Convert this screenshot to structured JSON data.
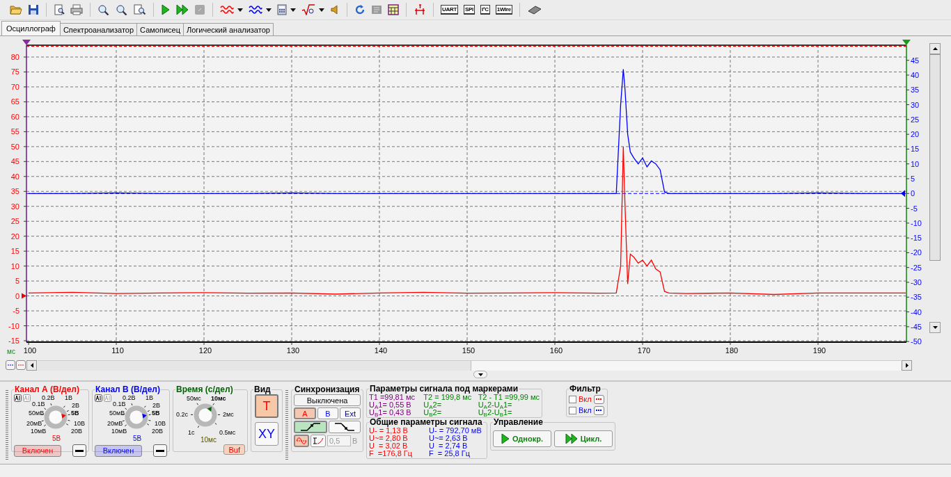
{
  "toolbar": [
    {
      "kind": "open"
    },
    {
      "kind": "save"
    },
    {
      "kind": "separator"
    },
    {
      "kind": "preview"
    },
    {
      "kind": "print"
    },
    {
      "kind": "separator"
    },
    {
      "kind": "zoom"
    },
    {
      "kind": "zoom"
    },
    {
      "kind": "zoom-page"
    },
    {
      "kind": "separator"
    },
    {
      "kind": "play"
    },
    {
      "kind": "play-fast"
    },
    {
      "kind": "stop",
      "disabled": true
    },
    {
      "kind": "separator"
    },
    {
      "kind": "wave",
      "color": "#ff0000",
      "dropdown": true
    },
    {
      "kind": "wave",
      "color": "#0000ff",
      "dropdown": true
    },
    {
      "kind": "calculator",
      "dropdown": true
    },
    {
      "kind": "sqrt",
      "dropdown": true
    },
    {
      "kind": "speaker"
    },
    {
      "kind": "separator"
    },
    {
      "kind": "refresh"
    },
    {
      "kind": "note"
    },
    {
      "kind": "table"
    },
    {
      "kind": "separator"
    },
    {
      "kind": "marker"
    },
    {
      "kind": "separator"
    },
    {
      "kind": "protocol",
      "label": "UART"
    },
    {
      "kind": "protocol",
      "label": "SPI"
    },
    {
      "kind": "protocol",
      "label": "I²C"
    },
    {
      "kind": "protocol",
      "label": "1Wire"
    },
    {
      "kind": "separator"
    },
    {
      "kind": "chip"
    }
  ],
  "tabs": [
    {
      "label": "Осциллограф",
      "selected": true
    },
    {
      "label": "Спектроанализатор",
      "selected": false
    },
    {
      "label": "Самописец",
      "selected": false
    },
    {
      "label": "Логический анализатор",
      "selected": false
    }
  ],
  "scope": {
    "chart_data": {
      "type": "line",
      "grid": true,
      "ref_lines": [
        {
          "axis": "y2",
          "value": 0,
          "color": "#0000ff"
        }
      ],
      "xlabel": "мс",
      "xlim": [
        99.76,
        200.08
      ],
      "ylim": [
        -15.46,
        83.96
      ],
      "y2lim": [
        -50.2,
        50.1
      ],
      "xticks": [
        100,
        110,
        120,
        130,
        140,
        150,
        160,
        170,
        180,
        190
      ],
      "yticks": [
        -15,
        -10,
        -5,
        0,
        5,
        10,
        15,
        20,
        25,
        30,
        35,
        40,
        45,
        50,
        55,
        60,
        65,
        70,
        75,
        80
      ],
      "y2ticks": [
        -50,
        -45,
        -40,
        -35,
        -30,
        -25,
        -20,
        -15,
        -10,
        -5,
        0,
        5,
        10,
        15,
        20,
        25,
        30,
        35,
        40,
        45
      ],
      "x": [
        100,
        105,
        110,
        115,
        120,
        125,
        130,
        135,
        140,
        145,
        150,
        155,
        160,
        165,
        167,
        167.5,
        167.8,
        168,
        168.3,
        168.6,
        169,
        169.5,
        170,
        170.5,
        171,
        171.5,
        172,
        172.5,
        173,
        175,
        180,
        185,
        190,
        195,
        200
      ],
      "series": [
        {
          "color": "#ff0000",
          "values": [
            1,
            1.2,
            0.8,
            1,
            1.1,
            0.9,
            1,
            0.6,
            1,
            1.2,
            0.9,
            1,
            1.1,
            0.9,
            1,
            10,
            50,
            30,
            4,
            14,
            13,
            11,
            12,
            10,
            12,
            9,
            8,
            1.5,
            1,
            0.8,
            1,
            0.5,
            1,
            1,
            1
          ]
        },
        {
          "color": "#0000ff",
          "axis": "y2",
          "values": [
            0,
            0,
            0.2,
            0,
            0,
            0,
            0.2,
            0,
            0,
            0,
            0,
            0,
            0,
            0,
            0,
            30,
            42,
            35,
            20,
            14,
            12,
            10,
            12,
            9,
            11,
            10,
            8,
            0.5,
            0,
            0,
            0,
            0,
            0.2,
            0,
            0
          ]
        }
      ]
    }
  },
  "knob_panels": [
    {
      "kind": "channel",
      "title": "Канал А (В/дел)",
      "color": "#ff0000",
      "scale": [
        {
          "label": "0.2В",
          "selected": false
        },
        {
          "label": "1В",
          "selected": false
        },
        {
          "label": "0.1В",
          "selected": false
        },
        {
          "label": "2В",
          "selected": false
        },
        {
          "label": "50мВ",
          "selected": false
        },
        {
          "label": "5В",
          "selected": true
        },
        {
          "label": "20мВ",
          "selected": false
        },
        {
          "label": "10В",
          "selected": false
        },
        {
          "label": "10мВ",
          "selected": false
        },
        {
          "label": "20В",
          "selected": false
        }
      ],
      "value": "5В",
      "power_button": "Включен"
    },
    {
      "kind": "channel",
      "title": "Канал B (В/дел)",
      "color": "#0000ff",
      "scale": [
        {
          "label": "0.2В",
          "selected": false
        },
        {
          "label": "1В",
          "selected": false
        },
        {
          "label": "0.1В",
          "selected": false
        },
        {
          "label": "2В",
          "selected": false
        },
        {
          "label": "50мВ",
          "selected": false
        },
        {
          "label": "5В",
          "selected": true
        },
        {
          "label": "20мВ",
          "selected": false
        },
        {
          "label": "10В",
          "selected": false
        },
        {
          "label": "10мВ",
          "selected": false
        },
        {
          "label": "20В",
          "selected": false
        }
      ],
      "value": "5В",
      "power_button": "Включен"
    },
    {
      "kind": "time",
      "title": "Время (с/дел)",
      "color": "#006400",
      "scale": [
        {
          "label": "50мс",
          "selected": false
        },
        {
          "label": "10мс",
          "selected": true
        },
        {
          "label": "0.2с",
          "selected": false
        },
        {
          "label": "2мс",
          "selected": false
        },
        {
          "label": "1с",
          "selected": false
        },
        {
          "label": "0.5мс",
          "selected": false
        }
      ],
      "value": "10мс",
      "buf_button": "Buf"
    }
  ],
  "view": {
    "title": "Вид",
    "buttons": [
      {
        "label": "T",
        "selected": true,
        "color": "#ff0000"
      },
      {
        "label": "XY",
        "selected": false,
        "color": "#0000ff"
      }
    ]
  },
  "sync": {
    "title": "Синхронизация",
    "mode_button": "Выключена",
    "sources": [
      {
        "label": "A",
        "selected": true,
        "color": "#ff0000"
      },
      {
        "label": "B",
        "selected": false,
        "color": "#0000ff"
      },
      {
        "label": "Ext",
        "selected": false,
        "color": "#000080"
      }
    ],
    "edges": [
      {
        "kind": "rising",
        "selected": true
      },
      {
        "kind": "falling",
        "selected": false
      }
    ],
    "modes": [
      {
        "kind": "wave",
        "selected": true
      },
      {
        "kind": "hysteresis",
        "selected": false
      }
    ],
    "level": {
      "value": "0,5",
      "disabled": true
    },
    "level_unit": "В"
  },
  "markers": {
    "title": "Параметры сигнала под маркерами",
    "columns": [
      {
        "color": "#800080",
        "lines": [
          "T1 =99,81 мс",
          "U$_{A}$1= 0,55 В",
          "U$_{B}$1= 0,43 В"
        ]
      },
      {
        "color": "#008000",
        "lines": [
          "T2 = 199,8 мс",
          "U$_{A}$2=",
          "U$_{B}$2="
        ]
      },
      {
        "color": "#008000",
        "lines": [
          "T2 - T1 =99,99 мс",
          "U$_{A}$2-U$_{A}$1=",
          "U$_{B}$2-U$_{B}$1="
        ]
      }
    ]
  },
  "filter": {
    "title": "Фильтр",
    "rows": [
      {
        "label": "Вкл",
        "checked": false,
        "color": "#ff0000"
      },
      {
        "label": "Вкл",
        "checked": false,
        "color": "#0000ff"
      }
    ]
  },
  "stats": {
    "title": "Общие параметры сигнала",
    "columns": [
      {
        "color": "#ff0000",
        "lines": [
          "U- = 1,13 В",
          "U~= 2,80 В",
          "U  = 3,02 В",
          "F  =176,8 Гц"
        ]
      },
      {
        "color": "#0000ff",
        "lines": [
          "U- = 792,70 мВ",
          "U~= 2,63 В",
          "U  = 2,74 В",
          "F  = 25,8 Гц"
        ]
      }
    ]
  },
  "control": {
    "title": "Управление",
    "buttons": [
      {
        "label": "Однокр.",
        "kind": "single"
      },
      {
        "label": "Цикл.",
        "kind": "cycle"
      }
    ]
  }
}
